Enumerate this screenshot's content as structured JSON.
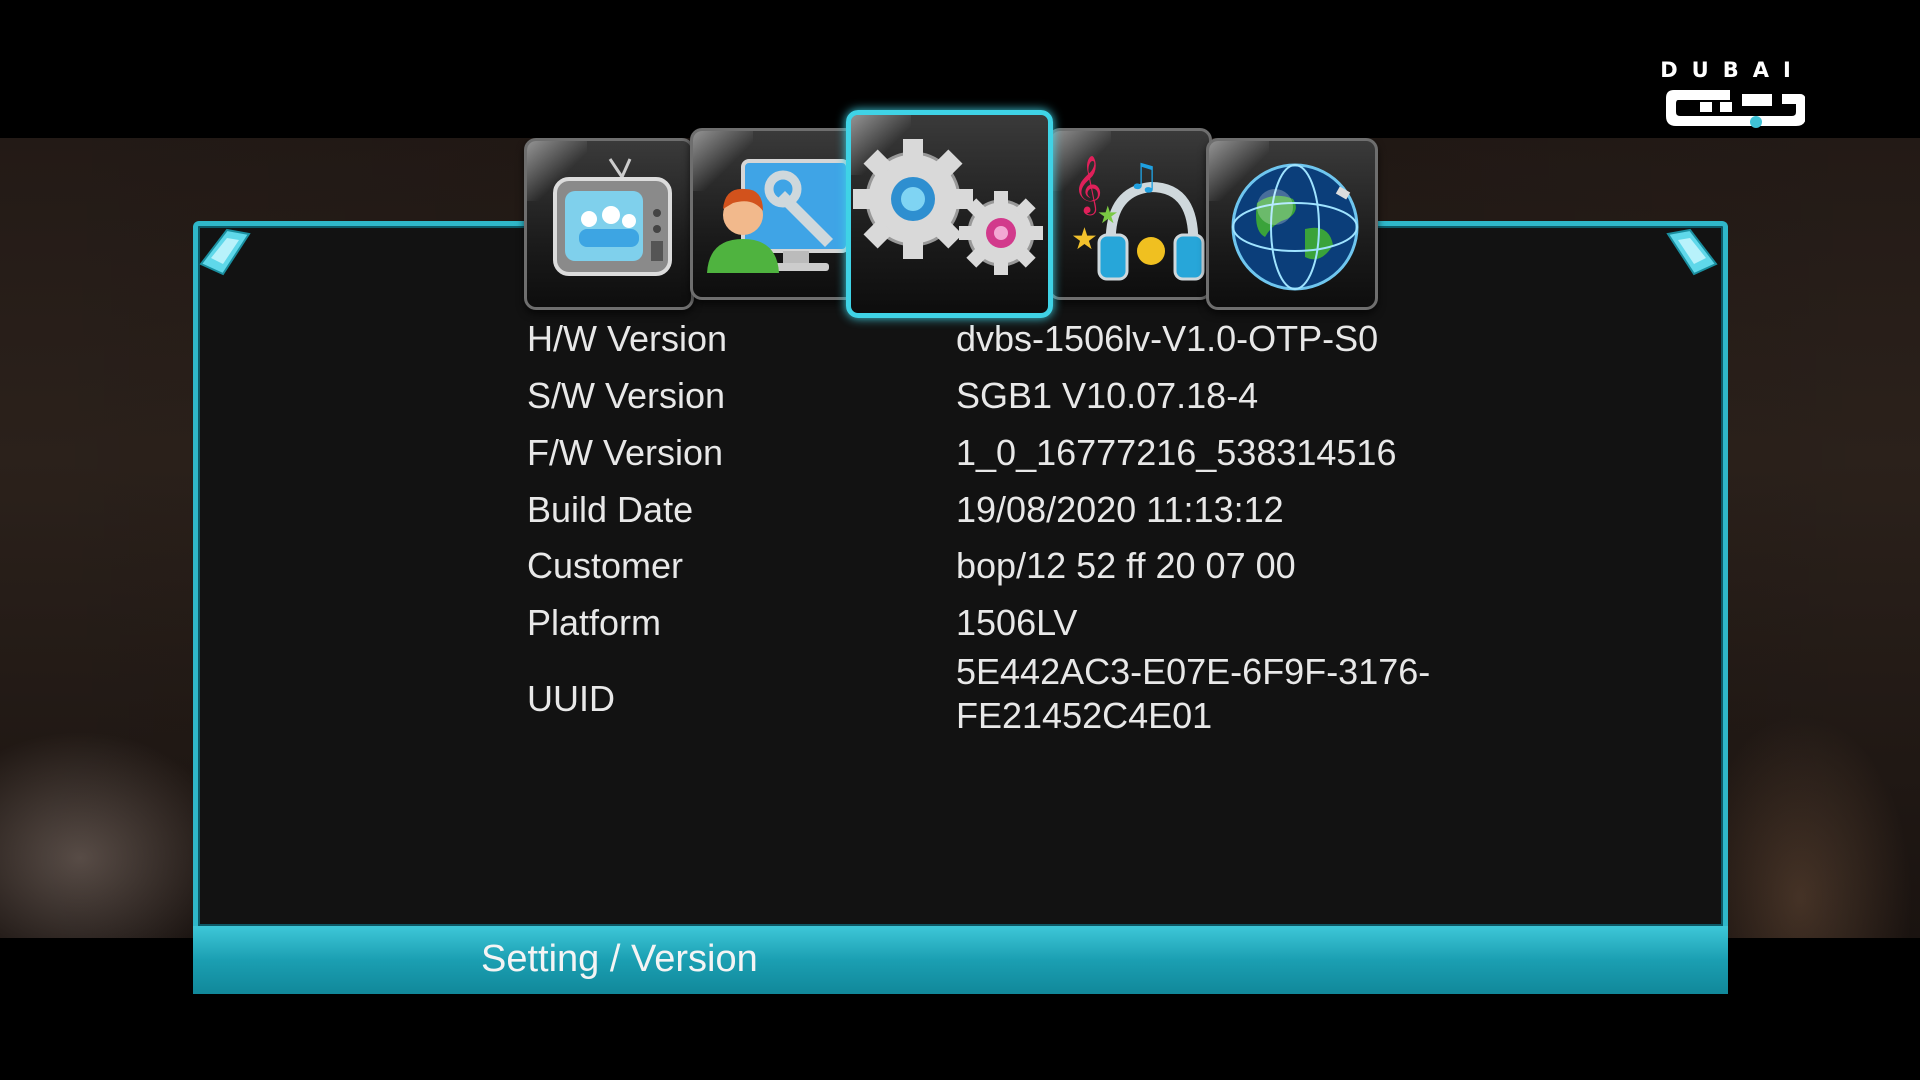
{
  "logo": {
    "text": "DUBAI"
  },
  "menu": {
    "tabs": [
      {
        "name": "tv",
        "icon": "tv-icon"
      },
      {
        "name": "user-tools",
        "icon": "user-settings-icon"
      },
      {
        "name": "settings",
        "icon": "gears-icon",
        "active": true
      },
      {
        "name": "media",
        "icon": "music-headphones-icon"
      },
      {
        "name": "network",
        "icon": "globe-icon"
      }
    ]
  },
  "info": {
    "rows": [
      {
        "label": "H/W Version",
        "value": "dvbs-1506lv-V1.0-OTP-S0"
      },
      {
        "label": "S/W Version",
        "value": "SGB1 V10.07.18-4"
      },
      {
        "label": "F/W Version",
        "value": "1_0_16777216_538314516"
      },
      {
        "label": "Build Date",
        "value": "19/08/2020 11:13:12"
      },
      {
        "label": "Customer",
        "value": "bop/12 52 ff 20 07 00"
      },
      {
        "label": "Platform",
        "value": "1506LV"
      }
    ],
    "uuid": {
      "label": "UUID",
      "value_line1": "5E442AC3-E07E-6F9F-3176-",
      "value_line2": "FE21452C4E01"
    }
  },
  "footer": {
    "title": "Setting / Version"
  },
  "colors": {
    "accent": "#2fb7c9",
    "panel": "#121212",
    "text": "#e8e8e8"
  }
}
